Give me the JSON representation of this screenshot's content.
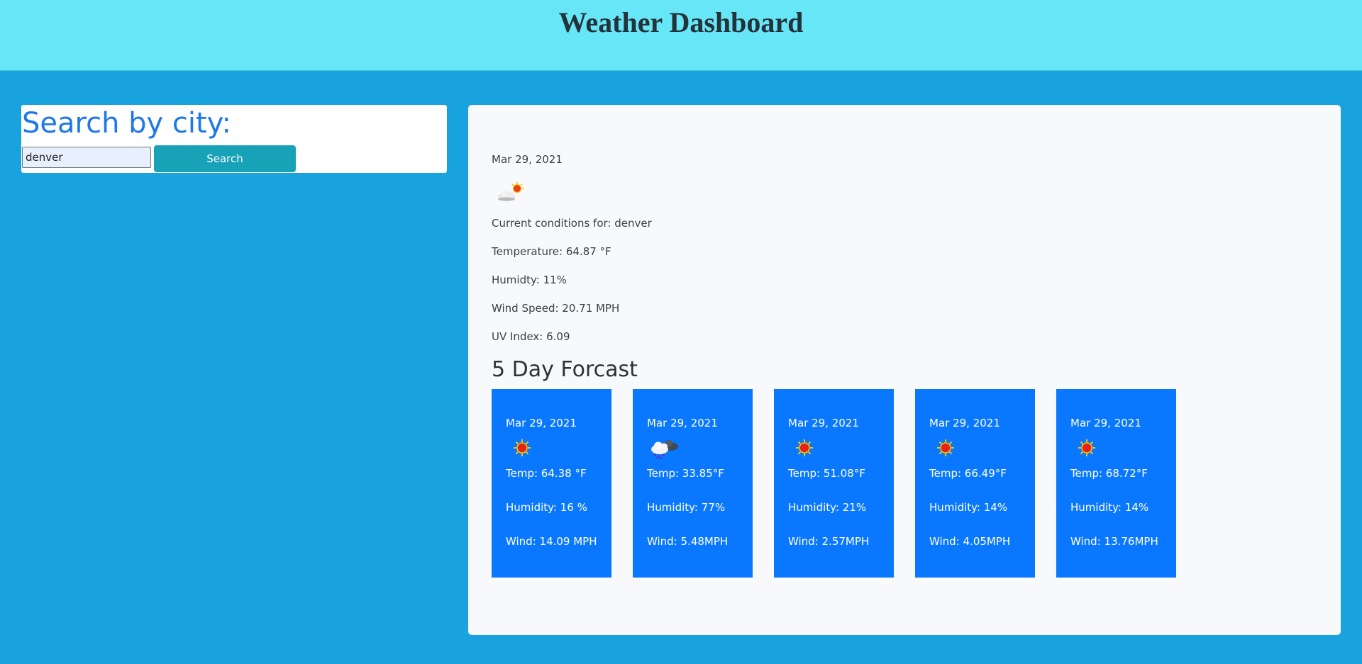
{
  "header": {
    "title": "Weather Dashboard"
  },
  "search": {
    "title": "Search by city:",
    "input_value": "denver",
    "button_label": "Search"
  },
  "current": {
    "date": "Mar 29, 2021",
    "icon": "partly-cloudy-icon",
    "conditions": "Current conditions for: denver",
    "temperature": "Temperature: 64.87 °F",
    "humidity": "Humidty: 11%",
    "wind": "Wind Speed: 20.71 MPH",
    "uv": "UV Index: 6.09"
  },
  "forecast": {
    "title": "5 Day Forcast",
    "days": [
      {
        "date": "Mar 29, 2021",
        "icon": "sun-icon",
        "temp": "Temp: 64.38 °F",
        "humidity": "Humidity: 16 %",
        "wind": "Wind: 14.09 MPH"
      },
      {
        "date": "Mar 29, 2021",
        "icon": "snow-cloud-icon",
        "temp": "Temp: 33.85°F",
        "humidity": "Humidity: 77%",
        "wind": "Wind: 5.48MPH"
      },
      {
        "date": "Mar 29, 2021",
        "icon": "sun-icon",
        "temp": "Temp: 51.08°F",
        "humidity": "Humidity: 21%",
        "wind": "Wind: 2.57MPH"
      },
      {
        "date": "Mar 29, 2021",
        "icon": "sun-icon",
        "temp": "Temp: 66.49°F",
        "humidity": "Humidity: 14%",
        "wind": "Wind: 4.05MPH"
      },
      {
        "date": "Mar 29, 2021",
        "icon": "sun-icon",
        "temp": "Temp: 68.72°F",
        "humidity": "Humidity: 14%",
        "wind": "Wind: 13.76MPH"
      }
    ]
  },
  "colors": {
    "header_bg": "#67e6f7",
    "page_bg": "#18a3de",
    "accent_title": "#1f78e9",
    "search_button": "#17a2b8",
    "forecast_card": "#0a78fe"
  }
}
